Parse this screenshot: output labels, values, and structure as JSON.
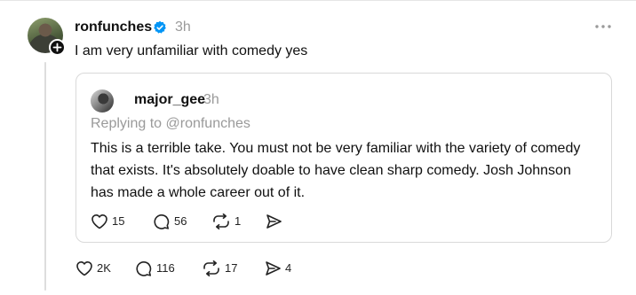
{
  "post": {
    "username": "ronfunches",
    "time": "3h",
    "text": "I am very unfamiliar with comedy yes",
    "actions": {
      "likes": "2K",
      "replies": "116",
      "reposts": "17",
      "shares": "4"
    }
  },
  "quote": {
    "username": "major_gee",
    "time": "3h",
    "replying_to": "Replying to @ronfunches",
    "text": "This is a terrible take. You must not be very familiar with the variety of comedy that exists. It's absolutely doable to have clean sharp comedy. Josh Johnson has made a whole career out of it.",
    "actions": {
      "likes": "15",
      "replies": "56",
      "reposts": "1"
    }
  },
  "icons": {
    "verified": "verified-badge-icon",
    "follow": "plus-icon",
    "more": "more-horizontal-icon",
    "like": "heart-icon",
    "reply": "comment-icon",
    "repost": "repost-icon",
    "share": "send-icon"
  },
  "colors": {
    "verified": "#0095f6",
    "muted_text": "#9a9a9a",
    "border": "#d9d9d9"
  }
}
